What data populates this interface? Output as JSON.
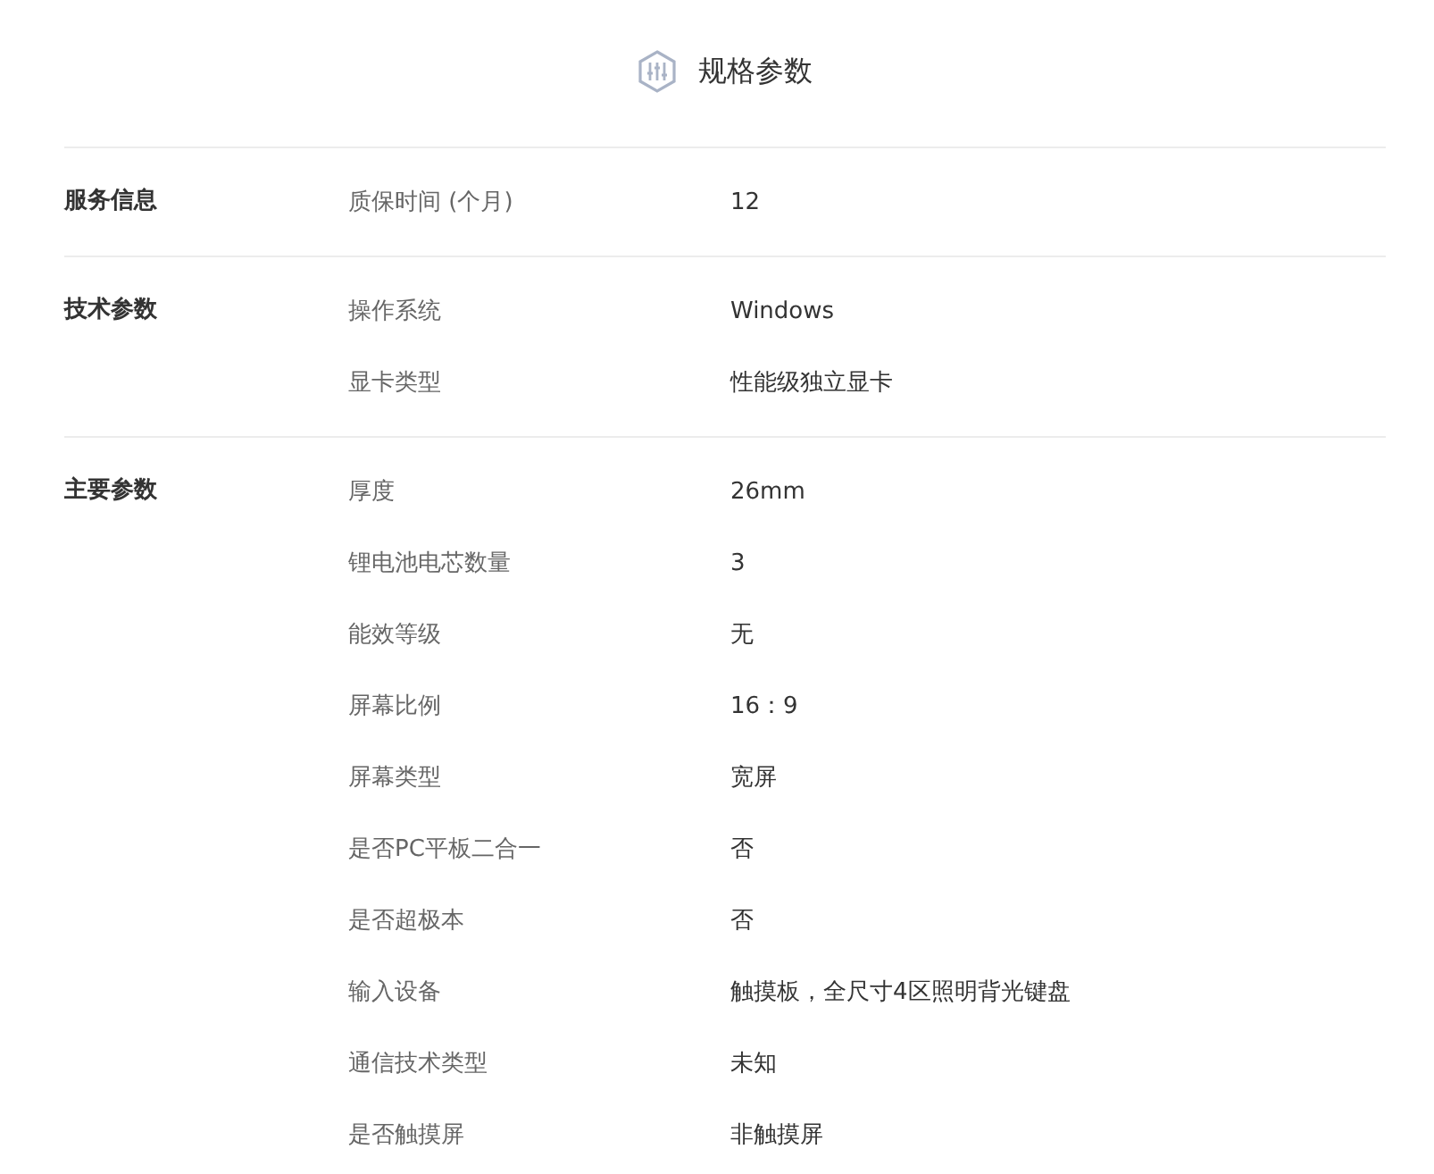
{
  "title": "规格参数",
  "groups": [
    {
      "name": "服务信息",
      "rows": [
        {
          "key": "质保时间 (个月)",
          "value": "12"
        }
      ]
    },
    {
      "name": "技术参数",
      "rows": [
        {
          "key": "操作系统",
          "value": "Windows"
        },
        {
          "key": "显卡类型",
          "value": "性能级独立显卡"
        }
      ]
    },
    {
      "name": "主要参数",
      "rows": [
        {
          "key": "厚度",
          "value": "26mm"
        },
        {
          "key": "锂电池电芯数量",
          "value": "3"
        },
        {
          "key": "能效等级",
          "value": "无"
        },
        {
          "key": "屏幕比例",
          "value": "16：9"
        },
        {
          "key": "屏幕类型",
          "value": "宽屏"
        },
        {
          "key": "是否PC平板二合一",
          "value": "否"
        },
        {
          "key": "是否超极本",
          "value": "否"
        },
        {
          "key": "输入设备",
          "value": "触摸板，全尺寸4区照明背光键盘"
        },
        {
          "key": "通信技术类型",
          "value": "未知"
        },
        {
          "key": "是否触摸屏",
          "value": "非触摸屏"
        }
      ]
    }
  ]
}
